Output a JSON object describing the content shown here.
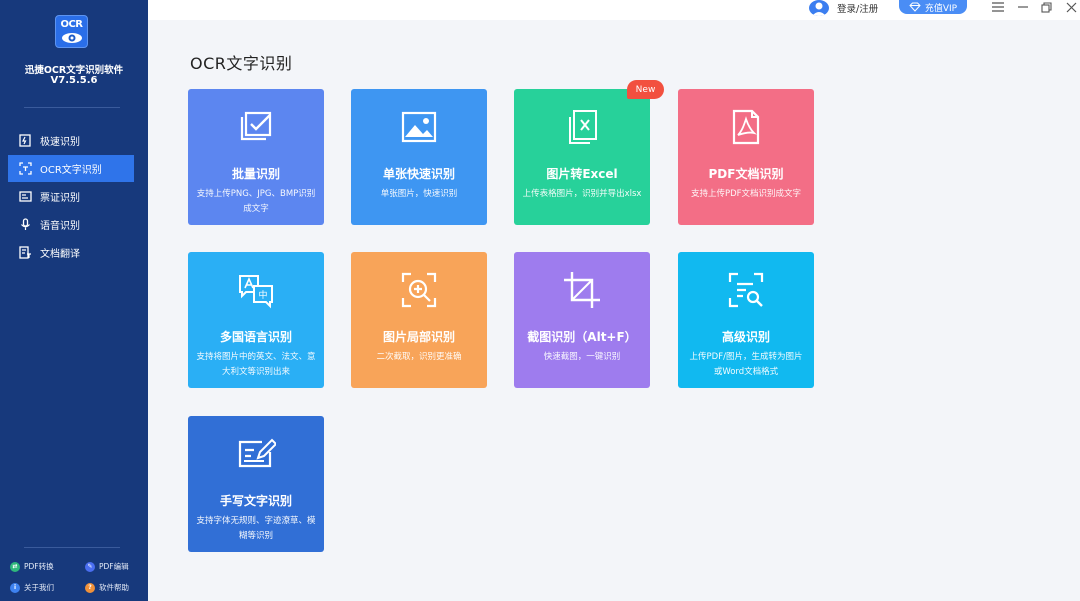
{
  "app": {
    "logo_text": "OCR",
    "name": "迅捷OCR文字识别软件",
    "version": "V7.5.5.6"
  },
  "sidebar": {
    "items": [
      {
        "label": "极速识别",
        "icon": "flash-doc-icon",
        "active": false
      },
      {
        "label": "OCR文字识别",
        "icon": "scan-text-icon",
        "active": true
      },
      {
        "label": "票证识别",
        "icon": "ticket-icon",
        "active": false
      },
      {
        "label": "语音识别",
        "icon": "microphone-icon",
        "active": false
      },
      {
        "label": "文档翻译",
        "icon": "translate-doc-icon",
        "active": false
      }
    ],
    "footer": [
      {
        "label": "PDF转换",
        "icon": "pdf-convert-icon",
        "color": "#2fb87c"
      },
      {
        "label": "PDF编辑",
        "icon": "pdf-edit-icon",
        "color": "#4a6ef0"
      },
      {
        "label": "关于我们",
        "icon": "about-icon",
        "color": "#3e82f0"
      },
      {
        "label": "软件帮助",
        "icon": "help-icon",
        "color": "#f0913a"
      }
    ]
  },
  "titlebar": {
    "login": "登录/注册",
    "vip": "充值VIP"
  },
  "main": {
    "title": "OCR文字识别",
    "new_badge": "New",
    "cards": [
      {
        "title": "批量识别",
        "desc": "支持上传PNG、JPG、BMP识别成文字",
        "color": "#5c86f0",
        "icon": "batch-check-icon"
      },
      {
        "title": "单张快速识别",
        "desc": "单张图片，快速识别",
        "color": "#3e96f2",
        "icon": "image-icon"
      },
      {
        "title": "图片转Excel",
        "desc": "上传表格图片，识别并导出xlsx",
        "color": "#27d19a",
        "icon": "excel-icon"
      },
      {
        "title": "PDF文档识别",
        "desc": "支持上传PDF文档识别成文字",
        "color": "#f36e86",
        "icon": "pdf-icon"
      },
      {
        "title": "多国语言识别",
        "desc": "支持将图片中的英文、法文、意大利文等识别出来",
        "color": "#2aaff5",
        "icon": "language-icon"
      },
      {
        "title": "图片局部识别",
        "desc": "二次截取，识别更准确",
        "color": "#f8a459",
        "icon": "zoom-in-icon"
      },
      {
        "title": "截图识别（Alt+F）",
        "desc": "快速截图，一键识别",
        "color": "#9e7cee",
        "icon": "crop-icon"
      },
      {
        "title": "高级识别",
        "desc": "上传PDF/图片，生成转为图片或Word文档格式",
        "color": "#11b9f0",
        "icon": "advanced-search-icon"
      },
      {
        "title": "手写文字识别",
        "desc": "支持字体无规则、字迹潦草、模糊等识别",
        "color": "#316fd6",
        "icon": "handwriting-icon"
      }
    ]
  }
}
